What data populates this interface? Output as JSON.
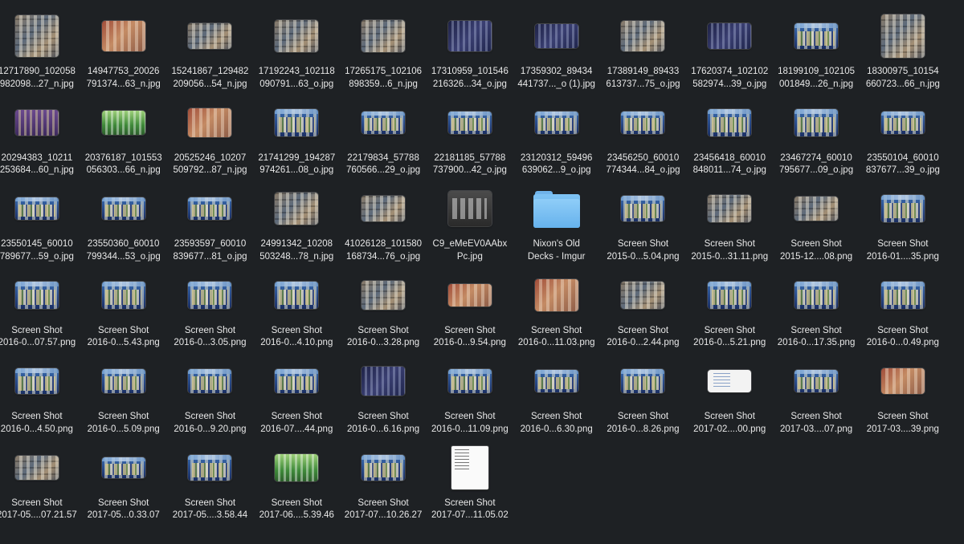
{
  "finder": {
    "items": [
      {
        "line1": "12717890_102058",
        "line2": "982098...27_n.jpg",
        "kind": "photo",
        "w": 54,
        "h": 52
      },
      {
        "line1": "14947753_20026",
        "line2": "791374...63_n.jpg",
        "kind": "photo-red",
        "w": 54,
        "h": 38
      },
      {
        "line1": "15241867_129482",
        "line2": "209056...54_n.jpg",
        "kind": "photo",
        "w": 54,
        "h": 32
      },
      {
        "line1": "17192243_102118",
        "line2": "090791...63_o.jpg",
        "kind": "photo",
        "w": 54,
        "h": 40
      },
      {
        "line1": "17265175_102106",
        "line2": "898359...6_n.jpg",
        "kind": "photo",
        "w": 54,
        "h": 40
      },
      {
        "line1": "17310959_101546",
        "line2": "216326...34_o.jpg",
        "kind": "photo-dark",
        "w": 54,
        "h": 38
      },
      {
        "line1": "17359302_89434",
        "line2": "441737..._o (1).jpg",
        "kind": "photo-dark",
        "w": 54,
        "h": 30
      },
      {
        "line1": "17389149_89433",
        "line2": "613737...75_o.jpg",
        "kind": "photo",
        "w": 54,
        "h": 38
      },
      {
        "line1": "17620374_102102",
        "line2": "582974...39_o.jpg",
        "kind": "photo-dark",
        "w": 54,
        "h": 32
      },
      {
        "line1": "18199109_102105",
        "line2": "001849...26_n.jpg",
        "kind": "deck",
        "w": 54,
        "h": 32
      },
      {
        "line1": "18300975_10154",
        "line2": "660723...66_n.jpg",
        "kind": "photo",
        "w": 54,
        "h": 54
      },
      {
        "line1": "20294383_10211",
        "line2": "253684...60_n.jpg",
        "kind": "purple",
        "w": 54,
        "h": 32
      },
      {
        "line1": "20376187_101553",
        "line2": "056303...66_n.jpg",
        "kind": "green",
        "w": 54,
        "h": 30
      },
      {
        "line1": "20525246_10207",
        "line2": "509792...87_n.jpg",
        "kind": "photo-red",
        "w": 54,
        "h": 36
      },
      {
        "line1": "21741299_194287",
        "line2": "974261...08_o.jpg",
        "kind": "deck",
        "w": 54,
        "h": 34
      },
      {
        "line1": "22179834_57788",
        "line2": "760566...29_o.jpg",
        "kind": "deck",
        "w": 54,
        "h": 28
      },
      {
        "line1": "22181185_57788",
        "line2": "737900...42_o.jpg",
        "kind": "deck",
        "w": 54,
        "h": 28
      },
      {
        "line1": "23120312_59496",
        "line2": "639062...9_o.jpg",
        "kind": "deck",
        "w": 54,
        "h": 28
      },
      {
        "line1": "23456250_60010",
        "line2": "774344...84_o.jpg",
        "kind": "deck",
        "w": 54,
        "h": 28
      },
      {
        "line1": "23456418_60010",
        "line2": "848011...74_o.jpg",
        "kind": "deck",
        "w": 54,
        "h": 34
      },
      {
        "line1": "23467274_60010",
        "line2": "795677...09_o.jpg",
        "kind": "deck",
        "w": 54,
        "h": 34
      },
      {
        "line1": "23550104_60010",
        "line2": "837677...39_o.jpg",
        "kind": "deck",
        "w": 54,
        "h": 28
      },
      {
        "line1": "23550145_60010",
        "line2": "789677...59_o.jpg",
        "kind": "deck",
        "w": 54,
        "h": 28
      },
      {
        "line1": "23550360_60010",
        "line2": "799344...53_o.jpg",
        "kind": "deck",
        "w": 54,
        "h": 28
      },
      {
        "line1": "23593597_60010",
        "line2": "839677...81_o.jpg",
        "kind": "deck",
        "w": 54,
        "h": 28
      },
      {
        "line1": "24991342_10208",
        "line2": "503248...78_n.jpg",
        "kind": "photo",
        "w": 54,
        "h": 40
      },
      {
        "line1": "41026128_101580",
        "line2": "168734...76_o.jpg",
        "kind": "photo",
        "w": 54,
        "h": 32
      },
      {
        "line1": "C9_eMeEV0AAbx",
        "line2": "Pc.jpg",
        "kind": "card",
        "w": 54,
        "h": 44
      },
      {
        "line1": "Nixon's Old",
        "line2": "Decks - Imgur",
        "kind": "folder",
        "w": 58,
        "h": 48
      },
      {
        "line1": "Screen Shot",
        "line2": "2015-0...5.04.png",
        "kind": "deck",
        "w": 54,
        "h": 32
      },
      {
        "line1": "Screen Shot",
        "line2": "2015-0...31.11.png",
        "kind": "photo",
        "w": 54,
        "h": 34
      },
      {
        "line1": "Screen Shot",
        "line2": "2015-12....08.png",
        "kind": "photo",
        "w": 54,
        "h": 30
      },
      {
        "line1": "Screen Shot",
        "line2": "2016-01....35.png",
        "kind": "deck",
        "w": 54,
        "h": 34
      },
      {
        "line1": "Screen Shot",
        "line2": "2016-0...07.57.png",
        "kind": "deck",
        "w": 54,
        "h": 34
      },
      {
        "line1": "Screen Shot",
        "line2": "2016-0...5.43.png",
        "kind": "deck",
        "w": 54,
        "h": 34
      },
      {
        "line1": "Screen Shot",
        "line2": "2016-0...3.05.png",
        "kind": "deck",
        "w": 54,
        "h": 34
      },
      {
        "line1": "Screen Shot",
        "line2": "2016-0...4.10.png",
        "kind": "deck",
        "w": 54,
        "h": 34
      },
      {
        "line1": "Screen Shot",
        "line2": "2016-0...3.28.png",
        "kind": "photo",
        "w": 54,
        "h": 36
      },
      {
        "line1": "Screen Shot",
        "line2": "2016-0...9.54.png",
        "kind": "photo-red",
        "w": 54,
        "h": 28
      },
      {
        "line1": "Screen Shot",
        "line2": "2016-0...11.03.png",
        "kind": "photo-red",
        "w": 54,
        "h": 40
      },
      {
        "line1": "Screen Shot",
        "line2": "2016-0...2.44.png",
        "kind": "photo",
        "w": 54,
        "h": 34
      },
      {
        "line1": "Screen Shot",
        "line2": "2016-0...5.21.png",
        "kind": "deck",
        "w": 54,
        "h": 34
      },
      {
        "line1": "Screen Shot",
        "line2": "2016-0...17.35.png",
        "kind": "deck",
        "w": 54,
        "h": 34
      },
      {
        "line1": "Screen Shot",
        "line2": "2016-0...0.49.png",
        "kind": "deck",
        "w": 54,
        "h": 34
      },
      {
        "line1": "Screen Shot",
        "line2": "2016-0...4.50.png",
        "kind": "deck",
        "w": 54,
        "h": 32
      },
      {
        "line1": "Screen Shot",
        "line2": "2016-0...5.09.png",
        "kind": "deck",
        "w": 54,
        "h": 30
      },
      {
        "line1": "Screen Shot",
        "line2": "2016-0...9.20.png",
        "kind": "deck",
        "w": 54,
        "h": 30
      },
      {
        "line1": "Screen Shot",
        "line2": "2016-07....44.png",
        "kind": "deck",
        "w": 54,
        "h": 30
      },
      {
        "line1": "Screen Shot",
        "line2": "2016-0...6.16.png",
        "kind": "photo-dark",
        "w": 54,
        "h": 36
      },
      {
        "line1": "Screen Shot",
        "line2": "2016-0...11.09.png",
        "kind": "deck",
        "w": 54,
        "h": 30
      },
      {
        "line1": "Screen Shot",
        "line2": "2016-0...6.30.png",
        "kind": "deck",
        "w": 54,
        "h": 28
      },
      {
        "line1": "Screen Shot",
        "line2": "2016-0...8.26.png",
        "kind": "deck",
        "w": 54,
        "h": 30
      },
      {
        "line1": "Screen Shot",
        "line2": "2017-02....00.png",
        "kind": "white",
        "w": 54,
        "h": 28
      },
      {
        "line1": "Screen Shot",
        "line2": "2017-03....07.png",
        "kind": "deck",
        "w": 54,
        "h": 28
      },
      {
        "line1": "Screen Shot",
        "line2": "2017-03....39.png",
        "kind": "photo-red",
        "w": 54,
        "h": 32
      },
      {
        "line1": "Screen Shot",
        "line2": "2017-05....07.21.57",
        "kind": "photo",
        "w": 54,
        "h": 30
      },
      {
        "line1": "Screen Shot",
        "line2": "2017-05...0.33.07",
        "kind": "deck",
        "w": 54,
        "h": 26
      },
      {
        "line1": "Screen Shot",
        "line2": "2017-05....3.58.44",
        "kind": "deck",
        "w": 54,
        "h": 32
      },
      {
        "line1": "Screen Shot",
        "line2": "2017-06....5.39.46",
        "kind": "green",
        "w": 54,
        "h": 34
      },
      {
        "line1": "Screen Shot",
        "line2": "2017-07...10.26.27",
        "kind": "deck",
        "w": 54,
        "h": 32
      },
      {
        "line1": "Screen Shot",
        "line2": "2017-07...11.05.02",
        "kind": "doc",
        "w": 46,
        "h": 54
      }
    ]
  }
}
